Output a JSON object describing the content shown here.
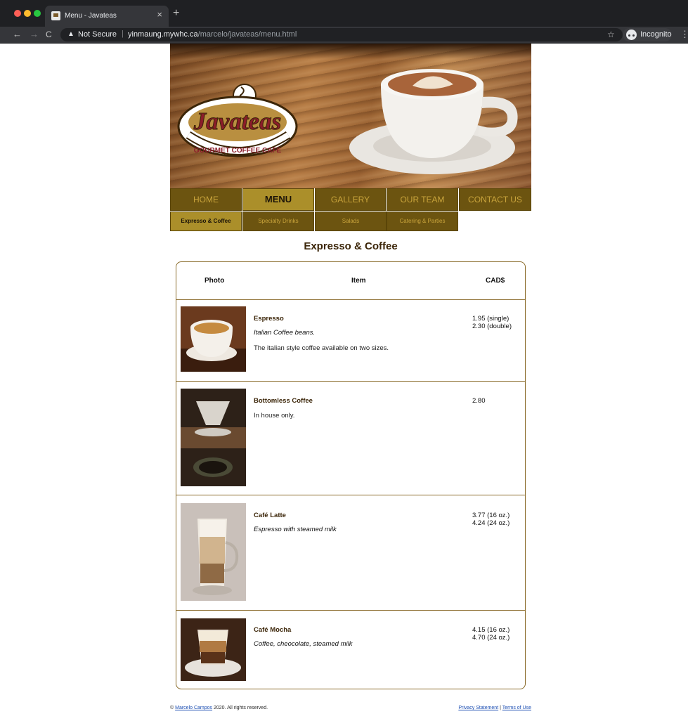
{
  "browser": {
    "tab_title": "Menu - Javateas",
    "tab_close": "×",
    "new_tab": "+",
    "back": "←",
    "forward": "→",
    "reload": "C",
    "security_icon": "▲",
    "security_label": "Not Secure",
    "url_separator": "|",
    "url_host": "yinmaung.mywhc.ca",
    "url_path": "/marcelo/javateas/menu.html",
    "bookmark_star": "☆",
    "profile_label": "Incognito",
    "menu_icon": "⋮"
  },
  "header": {
    "logo_script": "Javateas",
    "logo_arc": "GOURMET COFFEE CAFE"
  },
  "nav": {
    "items": [
      "HOME",
      "MENU",
      "GALLERY",
      "OUR TEAM",
      "CONTACT US"
    ],
    "active": "MENU"
  },
  "subnav": {
    "items": [
      "Expresso & Coffee",
      "Specialty Drinks",
      "Salads",
      "Catering & Parties"
    ],
    "active": "Expresso & Coffee"
  },
  "section_title": "Expresso & Coffee",
  "table": {
    "headers": {
      "photo": "Photo",
      "item": "Item",
      "price": "CAD$"
    },
    "rows": [
      {
        "name": "Espresso",
        "description": "Italian Coffee beans.",
        "note": "The italian style coffee available on two sizes.",
        "price_1": "1.95 (single)",
        "price_2": "2.30 (double)"
      },
      {
        "name": "Bottomless Coffee",
        "note": "In house only.",
        "price_1": "2.80"
      },
      {
        "name": "Café Latte",
        "description": "Espresso with steamed milk",
        "price_1": "3.77 (16 oz.)",
        "price_2": "4.24 (24 oz.)"
      },
      {
        "name": "Café Mocha",
        "description": "Coffee, cheocolate, steamed milk",
        "price_1": "4.15 (16 oz.)",
        "price_2": "4.70 (24 oz.)"
      }
    ]
  },
  "footer": {
    "copyright_symbol": "©",
    "author": "Marcelo Campos",
    "copyright_text": "2020. All rights reserved.",
    "privacy": "Privacy Statement",
    "divider": "|",
    "terms": "Terms of Use"
  },
  "colors": {
    "nav_bg": "#6c5410",
    "nav_active_bg": "#ab8f2a",
    "nav_text": "#c9a43c",
    "accent_brown": "#3b2508",
    "table_border": "#8a6b2a",
    "link": "#1d4fb3"
  }
}
